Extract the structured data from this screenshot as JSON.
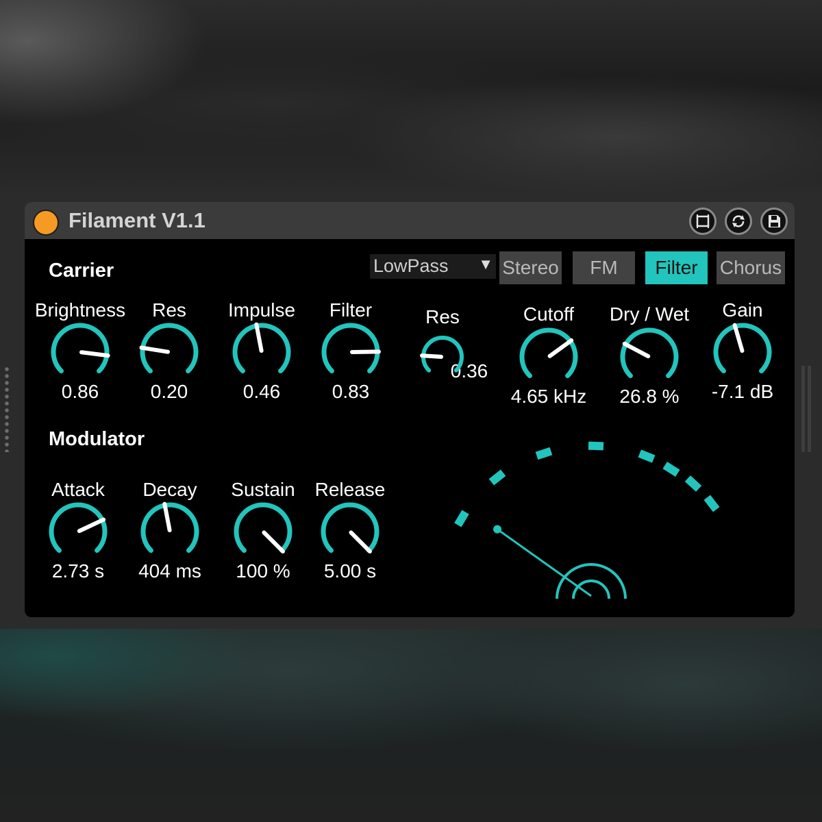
{
  "window": {
    "title": "Filament V1.1",
    "power": "power-icon",
    "buttons": [
      {
        "icon": "window-icon"
      },
      {
        "icon": "refresh-icon"
      },
      {
        "icon": "save-icon"
      }
    ]
  },
  "colors": {
    "accent": "#22c5bd",
    "power": "#f59a23",
    "panel": "#000000",
    "titlebar": "#3b3b3b"
  },
  "carrier": {
    "label": "Carrier",
    "knobs": [
      {
        "label": "Brightness",
        "value": "0.86",
        "level": 0.86
      },
      {
        "label": "Res",
        "value": "0.20",
        "level": 0.2
      },
      {
        "label": "Impulse",
        "value": "0.46",
        "level": 0.46
      },
      {
        "label": "Filter",
        "value": "0.83",
        "level": 0.83
      }
    ]
  },
  "filter": {
    "type": "LowPass",
    "tabs": [
      "Stereo",
      "FM",
      "Filter",
      "Chorus"
    ],
    "active_tab": "Filter",
    "knobs": [
      {
        "label": "Res",
        "value": "0.36",
        "level": 0.18
      },
      {
        "label": "Cutoff",
        "value": "4.65 kHz",
        "level": 0.7
      },
      {
        "label": "Dry / Wet",
        "value": "26.8 %",
        "level": 0.27
      },
      {
        "label": "Gain",
        "value": "-7.1 dB",
        "level": 0.44
      }
    ]
  },
  "modulator": {
    "label": "Modulator",
    "knobs": [
      {
        "label": "Attack",
        "value": "2.73 s",
        "level": 0.74
      },
      {
        "label": "Decay",
        "value": "404 ms",
        "level": 0.46
      },
      {
        "label": "Sustain",
        "value": "100 %",
        "level": 1.0
      },
      {
        "label": "Release",
        "value": "5.00 s",
        "level": 1.0
      }
    ]
  },
  "meter": {
    "type": "needle-meter",
    "level": 0.08
  }
}
